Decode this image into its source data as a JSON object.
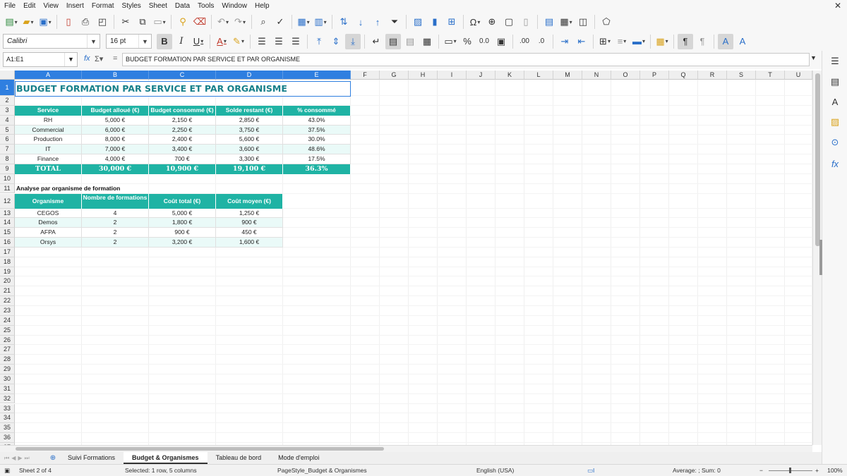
{
  "menu": [
    "File",
    "Edit",
    "View",
    "Insert",
    "Format",
    "Styles",
    "Sheet",
    "Data",
    "Tools",
    "Window",
    "Help"
  ],
  "font": {
    "name": "Calibri",
    "size": "16 pt"
  },
  "formula_bar": {
    "name_box": "A1:E1",
    "content": "BUDGET FORMATION PAR SERVICE ET PAR ORGANISME"
  },
  "columns": [
    "A",
    "B",
    "C",
    "D",
    "E",
    "F",
    "G",
    "H",
    "I",
    "J",
    "K",
    "L",
    "M",
    "N",
    "O",
    "P",
    "Q",
    "R",
    "S",
    "T",
    "U"
  ],
  "rows": [
    "1",
    "2",
    "3",
    "4",
    "5",
    "6",
    "7",
    "8",
    "9",
    "10",
    "11",
    "12",
    "13",
    "14",
    "15",
    "16",
    "17",
    "18",
    "19",
    "20",
    "21",
    "22",
    "23",
    "24",
    "25",
    "26",
    "27",
    "28",
    "29",
    "30",
    "31",
    "32",
    "33",
    "34",
    "35",
    "36",
    "37"
  ],
  "sheet": {
    "title": "BUDGET FORMATION PAR SERVICE ET PAR ORGANISME",
    "table1": {
      "headers": [
        "Service",
        "Budget alloué (€)",
        "Budget consommé (€)",
        "Solde restant (€)",
        "% consommé"
      ],
      "rows": [
        [
          "RH",
          "5,000 €",
          "2,150 €",
          "2,850 €",
          "43.0%"
        ],
        [
          "Commercial",
          "6,000 €",
          "2,250 €",
          "3,750 €",
          "37.5%"
        ],
        [
          "Production",
          "8,000 €",
          "2,400 €",
          "5,600 €",
          "30.0%"
        ],
        [
          "IT",
          "7,000 €",
          "3,400 €",
          "3,600 €",
          "48.6%"
        ],
        [
          "Finance",
          "4,000 €",
          "700 €",
          "3,300 €",
          "17.5%"
        ]
      ],
      "total": [
        "TOTAL",
        "30,000 €",
        "10,900 €",
        "19,100 €",
        "36.3%"
      ]
    },
    "section_label": "Analyse par organisme de formation",
    "table2": {
      "headers": [
        "Organisme",
        "Nombre de formations",
        "Coût total (€)",
        "Coût moyen (€)"
      ],
      "rows": [
        [
          "CEGOS",
          "4",
          "5,000 €",
          "1,250 €"
        ],
        [
          "Demos",
          "2",
          "1,800 €",
          "900 €"
        ],
        [
          "AFPA",
          "2",
          "900 €",
          "450 €"
        ],
        [
          "Orsys",
          "2",
          "3,200 €",
          "1,600 €"
        ]
      ]
    }
  },
  "tabs": [
    "Suivi Formations",
    "Budget & Organismes",
    "Tableau de bord",
    "Mode d'emploi"
  ],
  "active_tab": "Budget & Organismes",
  "status": {
    "sheet_pos": "Sheet 2 of 4",
    "selection": "Selected: 1 row, 5 columns",
    "page_style": "PageStyle_Budget & Organismes",
    "language": "English (USA)",
    "summary": "Average: ; Sum: 0",
    "zoom": "100%"
  },
  "colors": {
    "header_teal": "#1fb3a4",
    "title_teal": "#17808a",
    "selection_blue": "#2f7fe0"
  }
}
